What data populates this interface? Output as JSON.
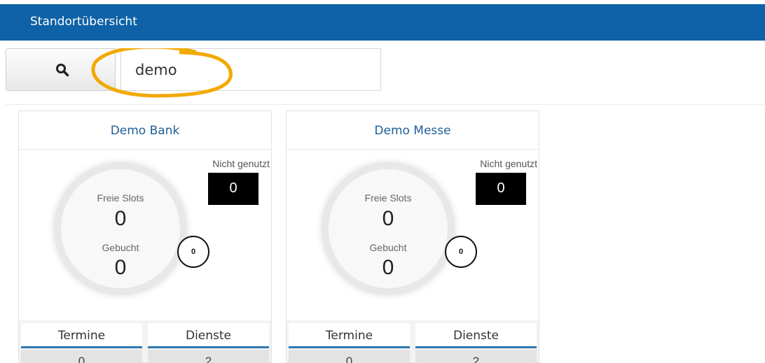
{
  "header": {
    "title": "Standortübersicht"
  },
  "search": {
    "value": "demo",
    "icon": "search-icon"
  },
  "colors": {
    "header_bg": "#0f62a7",
    "highlight": "#f2a900",
    "tab_underline": "#2d79b1"
  },
  "cards": [
    {
      "title": "Demo Bank",
      "free_slots_label": "Freie Slots",
      "free_slots": "0",
      "booked_label": "Gebucht",
      "booked": "0",
      "mini_value": "0",
      "unused_label": "Nicht genutzt",
      "unused_value": "0",
      "tabs": [
        {
          "label": "Termine",
          "value": "0"
        },
        {
          "label": "Dienste",
          "value": "2"
        }
      ]
    },
    {
      "title": "Demo Messe",
      "free_slots_label": "Freie Slots",
      "free_slots": "0",
      "booked_label": "Gebucht",
      "booked": "0",
      "mini_value": "0",
      "unused_label": "Nicht genutzt",
      "unused_value": "0",
      "tabs": [
        {
          "label": "Termine",
          "value": "0"
        },
        {
          "label": "Dienste",
          "value": "2"
        }
      ]
    }
  ]
}
